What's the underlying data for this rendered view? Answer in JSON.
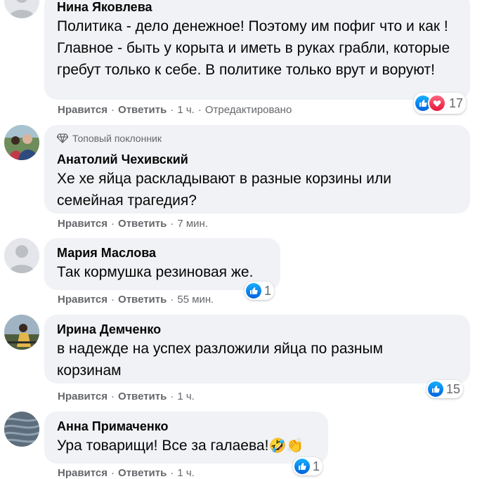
{
  "ui": {
    "like_label": "Нравится",
    "reply_label": "Ответить"
  },
  "comments": [
    {
      "author": "Нина Яковлева",
      "text": "Политика - дело денежное! Поэтому им пофиг что и как ! Главное - быть у корыта и иметь в руках грабли, которые гребут только к себе. В политике только врут и воруют!",
      "time": "1 ч.",
      "edited": "Отредактировано",
      "reactions": [
        "like",
        "love"
      ],
      "reaction_count": "17"
    },
    {
      "badge": "Топовый поклонник",
      "author": "Анатолий Чехивский",
      "text": "Хе хе яйца раскладывают в разные корзины или семейная трагедия?",
      "time": "7 мин."
    },
    {
      "author": "Мария Маслова",
      "text": "Так кормушка резиновая же.",
      "time": "55 мин.",
      "reactions": [
        "like"
      ],
      "reaction_count": "1"
    },
    {
      "author": "Ирина Демченко",
      "text": "в надежде на успех разложили яйца по разным корзинам",
      "time": "1 ч.",
      "reactions": [
        "like"
      ],
      "reaction_count": "15"
    },
    {
      "author": "Анна Примаченко",
      "text": "Ура товарищи! Все за галаева!",
      "text_emojis": "🤣👏",
      "time": "1 ч.",
      "reactions": [
        "like"
      ],
      "reaction_count": "1"
    }
  ]
}
